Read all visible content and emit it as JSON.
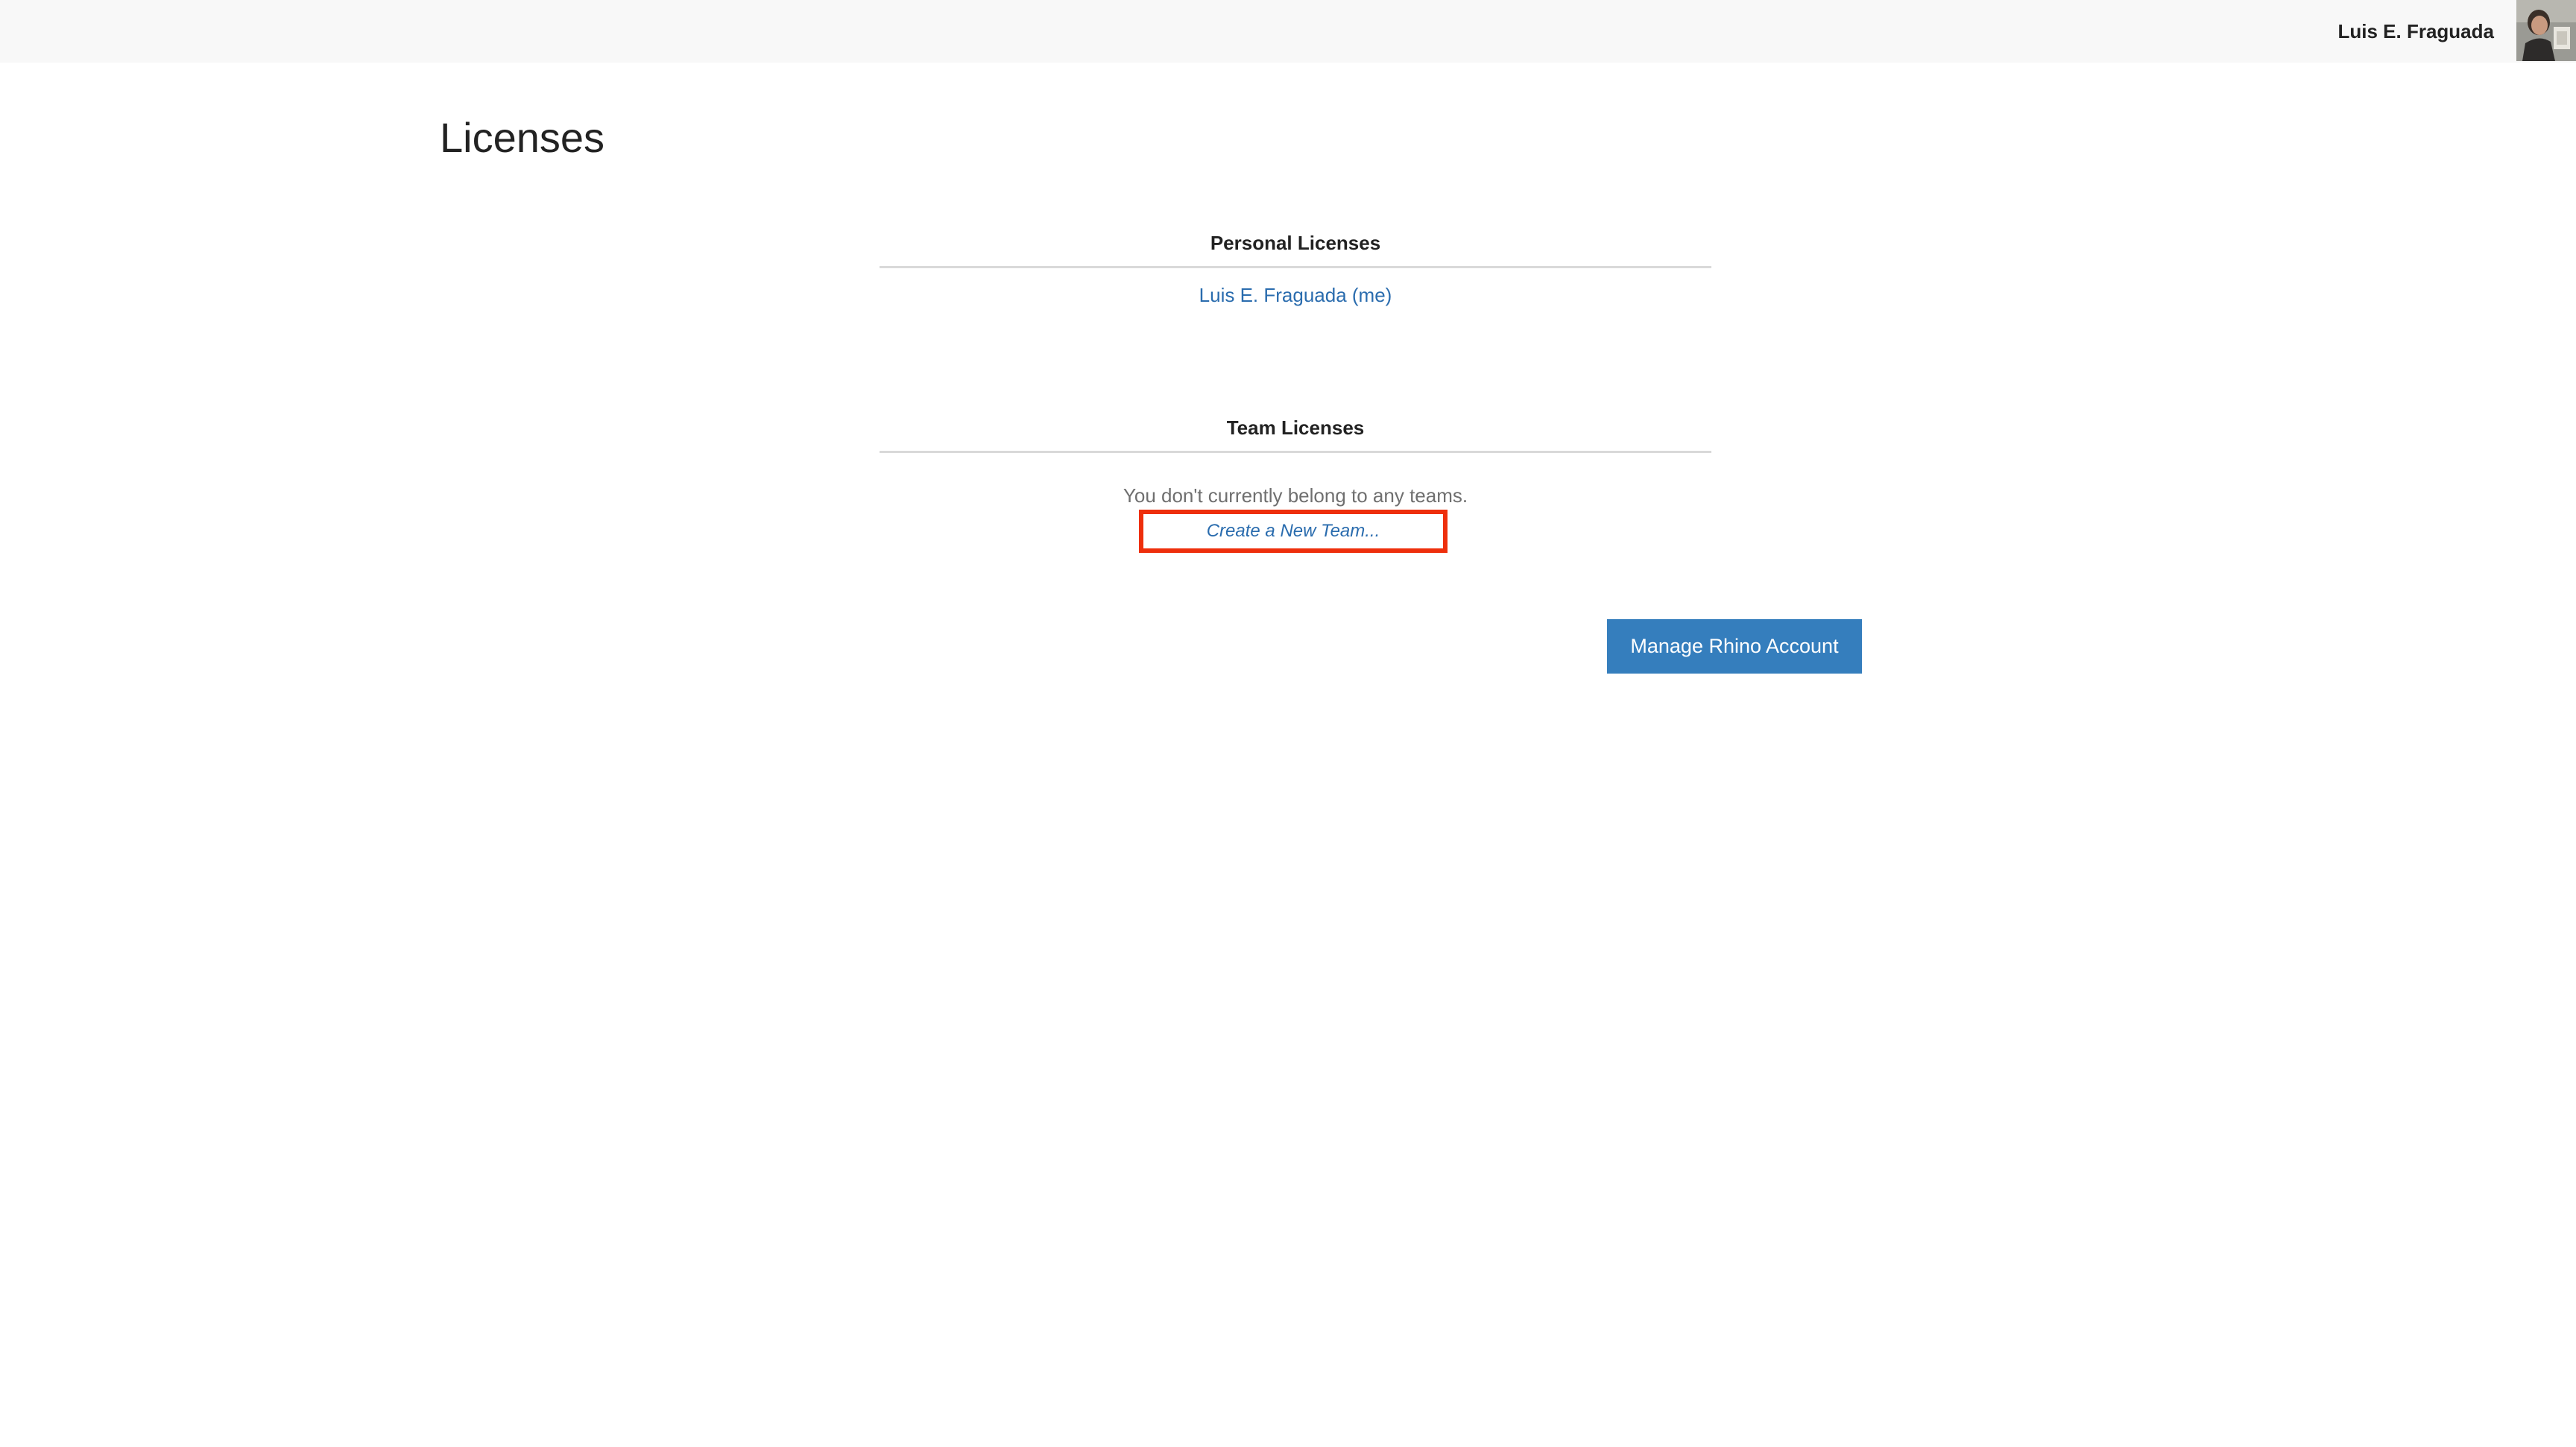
{
  "header": {
    "user_name": "Luis E. Fraguada",
    "avatar_icon": "user-avatar-photo"
  },
  "page": {
    "title": "Licenses"
  },
  "personal_licenses": {
    "heading": "Personal Licenses",
    "items": [
      {
        "label": "Luis E. Fraguada (me)"
      }
    ]
  },
  "team_licenses": {
    "heading": "Team Licenses",
    "empty_message": "You don't currently belong to any teams.",
    "create_link_label": "Create a New Team...",
    "highlight_color": "#ee2f0c"
  },
  "actions": {
    "manage_account_label": "Manage Rhino Account"
  },
  "colors": {
    "link": "#2a6cae",
    "primary_button": "#357ebd",
    "topbar": "#f8f8f8"
  }
}
